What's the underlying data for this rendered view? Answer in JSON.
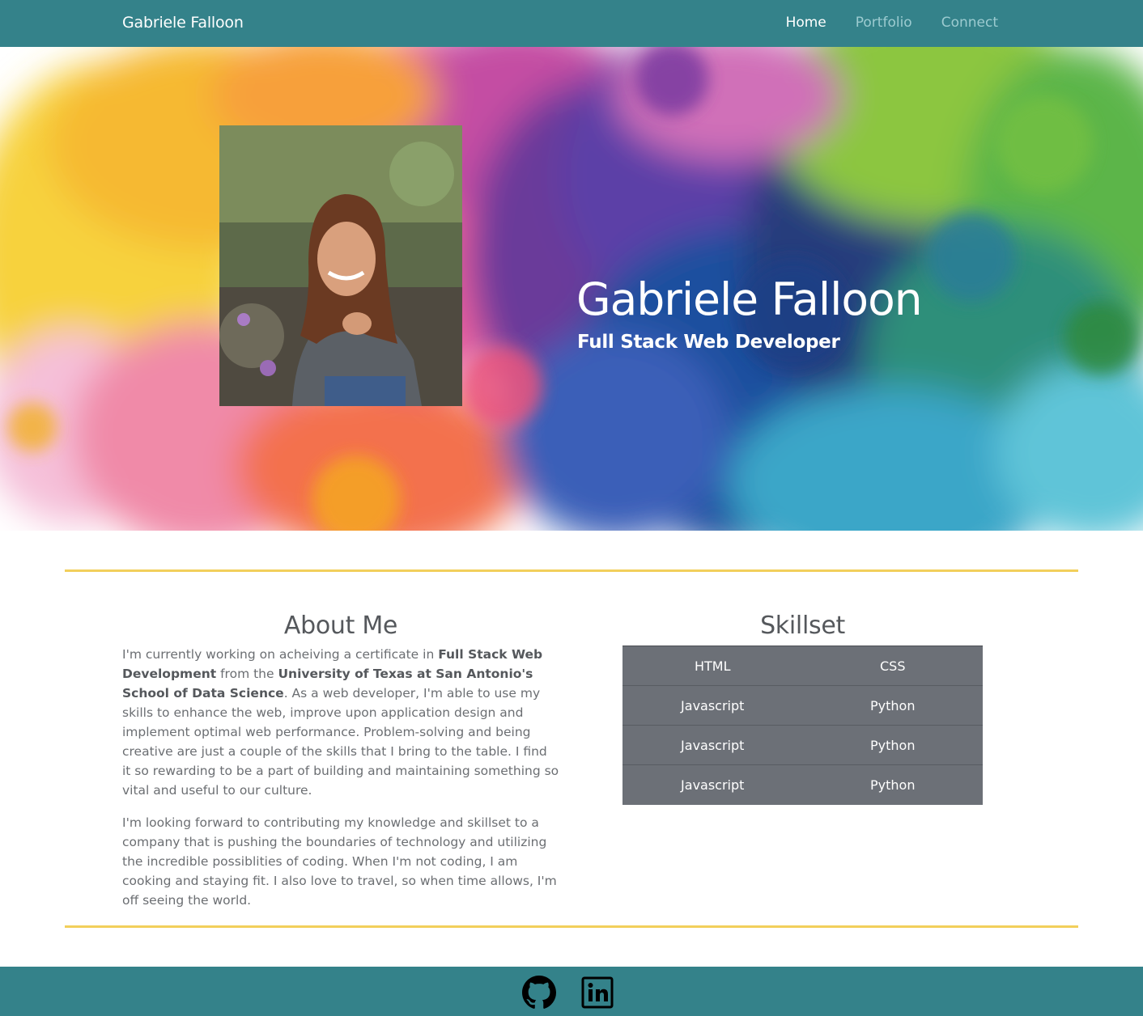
{
  "nav": {
    "brand": "Gabriele Falloon",
    "links": [
      {
        "label": "Home",
        "active": true
      },
      {
        "label": "Portfolio",
        "active": false
      },
      {
        "label": "Connect",
        "active": false
      }
    ]
  },
  "hero": {
    "name": "Gabriele Falloon",
    "subtitle": "Full Stack Web Developer"
  },
  "about": {
    "title": "About Me",
    "p1": {
      "t1": "I'm currently working on acheiving a certificate in ",
      "b1": "Full Stack Web Development",
      "t2": " from the ",
      "b2": "University of Texas at San Antonio's School of Data Science",
      "t3": ". As a web developer, I'm able to use my skills to enhance the web, improve upon application design and implement optimal web performance. Problem-solving and being creative are just a couple of the skills that I bring to the table. I find it so rewarding to be a part of building and maintaining something so vital and useful to our culture."
    },
    "p2": "I'm looking forward to contributing my knowledge and skillset to a company that is pushing the boundaries of technology and utilizing the incredible possiblities of coding. When I'm not coding, I am cooking and staying fit. I also love to travel, so when time allows, I'm off seeing the world."
  },
  "skills": {
    "title": "Skillset",
    "rows": [
      [
        "HTML",
        "CSS"
      ],
      [
        "Javascript",
        "Python"
      ],
      [
        "Javascript",
        "Python"
      ],
      [
        "Javascript",
        "Python"
      ]
    ]
  },
  "footer": {
    "icons": [
      "github-icon",
      "linkedin-icon"
    ]
  },
  "colors": {
    "nav_bg": "#34828a",
    "divider": "#f2cf5b",
    "table_bg": "#6c7077"
  }
}
